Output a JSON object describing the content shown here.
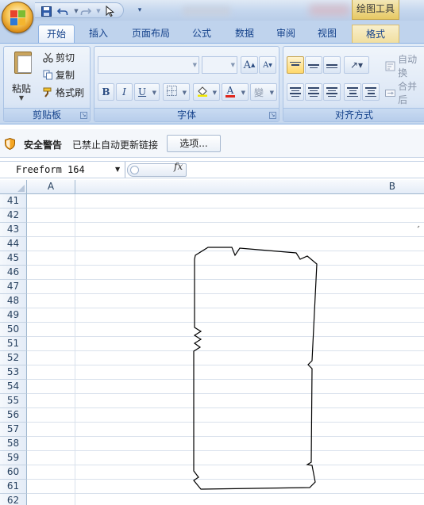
{
  "title_bar": {
    "contextual_tab_group": "绘图工具",
    "qat_icons": [
      "save-icon",
      "undo-icon",
      "redo-icon",
      "pointer-icon",
      "customize-dropdown-icon"
    ]
  },
  "tabs": [
    {
      "label": "开始",
      "active": true
    },
    {
      "label": "插入"
    },
    {
      "label": "页面布局"
    },
    {
      "label": "公式"
    },
    {
      "label": "数据"
    },
    {
      "label": "审阅"
    },
    {
      "label": "视图"
    },
    {
      "label": "格式",
      "contextual": true
    }
  ],
  "ribbon": {
    "clipboard": {
      "label": "剪贴板",
      "paste": "粘贴",
      "cut": "剪切",
      "copy": "复制",
      "format_painter": "格式刷"
    },
    "font": {
      "label": "字体",
      "font_name": "",
      "font_size": "",
      "bold": "B",
      "italic": "I",
      "underline": "U",
      "grow": "A",
      "shrink": "A",
      "font_color": "A",
      "phonetic": "變"
    },
    "alignment": {
      "label": "对齐方式",
      "wrap_text": "自动换",
      "merge_center": "合并后"
    }
  },
  "security_bar": {
    "title": "安全警告",
    "message": "已禁止自动更新链接",
    "options_button": "选项..."
  },
  "formula_bar": {
    "name_box": "Freeform 164",
    "fx": "fx"
  },
  "grid": {
    "columns": [
      "A",
      "B"
    ],
    "rows": [
      "41",
      "42",
      "43",
      "44",
      "45",
      "46",
      "47",
      "48",
      "49",
      "50",
      "51",
      "52",
      "53",
      "54",
      "55",
      "56",
      "57",
      "58",
      "59",
      "60",
      "61",
      "62"
    ]
  },
  "colors": {
    "ribbon_bg": "#d3e1f3",
    "tab_text": "#15428b",
    "contextual_tab": "#f1dfa0",
    "grid_line": "#d9e1ec",
    "header_border": "#9eb6ce"
  }
}
